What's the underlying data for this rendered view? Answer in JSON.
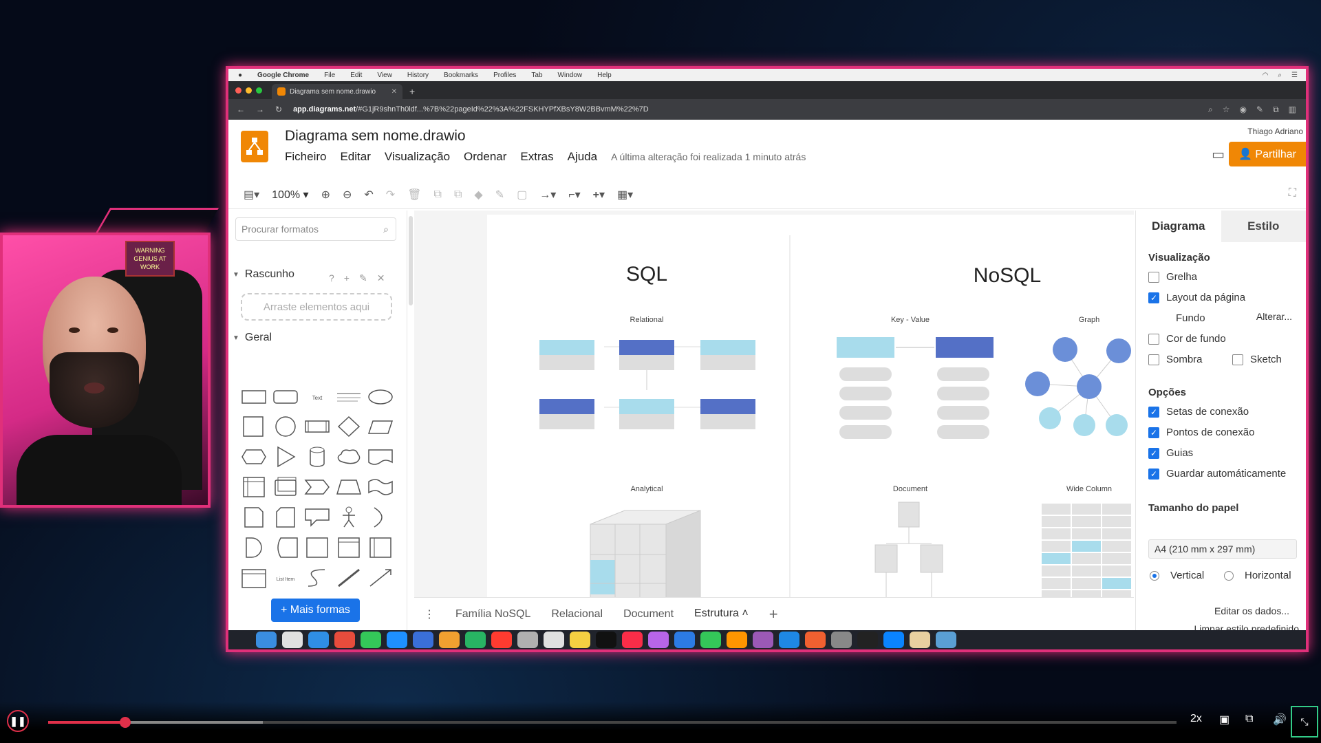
{
  "mac_menu": {
    "app": "Google Chrome",
    "items": [
      "File",
      "Edit",
      "View",
      "History",
      "Bookmarks",
      "Profiles",
      "Tab",
      "Window",
      "Help"
    ]
  },
  "browser": {
    "tab_title": "Diagrama sem nome.drawio",
    "url_host": "app.diagrams.net",
    "url_rest": "/#G1jR9shnTh0ldf...%7B%22pageId%22%3A%22FSKHYPfXBsY8W2BBvmM%22%7D"
  },
  "app": {
    "doc_title": "Diagrama sem nome.drawio",
    "menus": [
      "Ficheiro",
      "Editar",
      "Visualização",
      "Ordenar",
      "Extras",
      "Ajuda"
    ],
    "last_change": "A última alteração foi realizada 1 minuto atrás",
    "user": "Thiago Adriano",
    "share_label": "Partilhar",
    "zoom": "100%"
  },
  "sidebar": {
    "search_placeholder": "Procurar formatos",
    "scratch_title": "Rascunho",
    "drop_hint": "Arraste elementos aqui",
    "general_title": "Geral",
    "more_shapes": "+ Mais formas"
  },
  "canvas": {
    "sql_title": "SQL",
    "nosql_title": "NoSQL",
    "relational": "Relational",
    "key_value": "Key - Value",
    "graph": "Graph",
    "analytical": "Analytical",
    "document": "Document",
    "wide_column": "Wide Column"
  },
  "page_tabs": [
    "Família NoSQL",
    "Relacional",
    "Document",
    "Estrutura"
  ],
  "rpanel": {
    "tab_diagram": "Diagrama",
    "tab_style": "Estilo",
    "visual_title": "Visualização",
    "grid": "Grelha",
    "page_layout": "Layout da página",
    "background": "Fundo",
    "change": "Alterar...",
    "bg_color": "Cor de fundo",
    "shadow": "Sombra",
    "sketch": "Sketch",
    "options_title": "Opções",
    "conn_arrows": "Setas de conexão",
    "conn_points": "Pontos de conexão",
    "guides": "Guias",
    "autosave": "Guardar automáticamente",
    "paper_title": "Tamanho do papel",
    "paper_value": "A4 (210 mm x 297 mm)",
    "portrait": "Vertical",
    "landscape": "Horizontal",
    "edit_data": "Editar os dados...",
    "clear_style": "Limpar estilo predefinido"
  },
  "webcam": {
    "sign": "WARNING GENIUS AT WORK"
  },
  "player": {
    "speed": "2x",
    "progress_fraction": 0.068,
    "buffered_fraction": 0.19
  },
  "colors": {
    "accent": "#e0307a",
    "drawio_orange": "#f08705",
    "light_blue": "#a8dcec",
    "mid_blue": "#5470c6",
    "node_blue": "#6b8fd8"
  }
}
